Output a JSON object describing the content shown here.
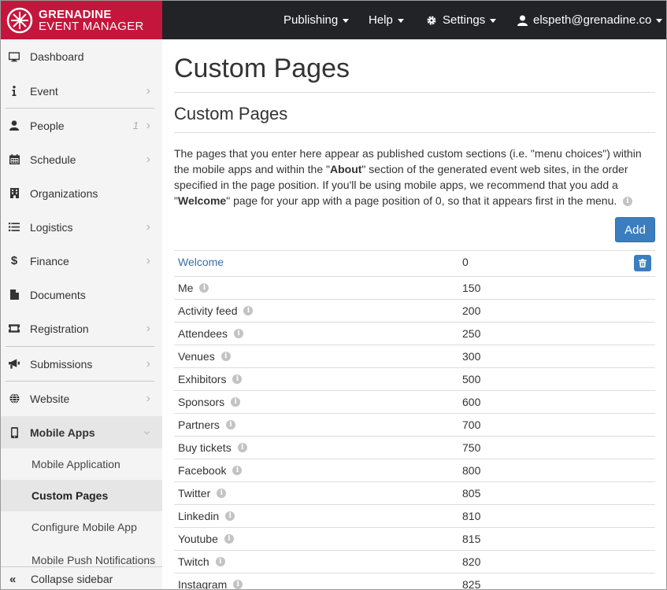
{
  "brand": {
    "line1": "GRENADINE",
    "line2": "EVENT MANAGER",
    "color": "#c4163c"
  },
  "topnav": {
    "publishing": "Publishing",
    "help": "Help",
    "settings": "Settings",
    "user": "elspeth@grenadine.co"
  },
  "sidebar": {
    "dashboard": "Dashboard",
    "event": "Event",
    "people": "People",
    "people_count": "1",
    "schedule": "Schedule",
    "organizations": "Organizations",
    "logistics": "Logistics",
    "finance": "Finance",
    "documents": "Documents",
    "registration": "Registration",
    "submissions": "Submissions",
    "website": "Website",
    "mobile_apps": "Mobile Apps",
    "sub_mobile_application": "Mobile Application",
    "sub_custom_pages": "Custom Pages",
    "sub_configure": "Configure Mobile App",
    "sub_push": "Mobile Push Notifications",
    "collapse": "Collapse sidebar"
  },
  "main": {
    "title": "Custom Pages",
    "subtitle": "Custom Pages",
    "desc_1": "The pages that you enter here appear as published custom sections (i.e. \"menu choices\") within the mobile apps and within the \"",
    "desc_bold_1": "About",
    "desc_2": "\" section of the generated event web sites, in the order specified in the page position. If you'll be using mobile apps, we recommend that you add a \"",
    "desc_bold_2": "Welcome",
    "desc_3": "\" page for your app with a page position of 0, so that it appears first in the menu.",
    "add_label": "Add"
  },
  "rows": [
    {
      "name": "Welcome",
      "position": "0"
    },
    {
      "name": "Me",
      "position": "150"
    },
    {
      "name": "Activity feed",
      "position": "200"
    },
    {
      "name": "Attendees",
      "position": "250"
    },
    {
      "name": "Venues",
      "position": "300"
    },
    {
      "name": "Exhibitors",
      "position": "500"
    },
    {
      "name": "Sponsors",
      "position": "600"
    },
    {
      "name": "Partners",
      "position": "700"
    },
    {
      "name": "Buy tickets",
      "position": "750"
    },
    {
      "name": "Facebook",
      "position": "800"
    },
    {
      "name": "Twitter",
      "position": "805"
    },
    {
      "name": "Linkedin",
      "position": "810"
    },
    {
      "name": "Youtube",
      "position": "815"
    },
    {
      "name": "Twitch",
      "position": "820"
    },
    {
      "name": "Instagram",
      "position": "825"
    }
  ],
  "colors": {
    "accent": "#3a7ebf",
    "link": "#3a70a8",
    "topbar": "#222326"
  }
}
